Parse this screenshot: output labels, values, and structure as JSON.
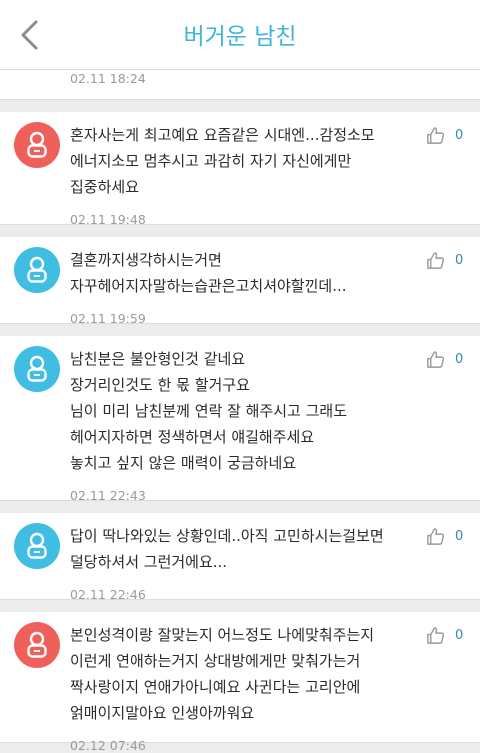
{
  "header": {
    "title": "버거운 남친"
  },
  "colors": {
    "accent": "#3fb6d8",
    "avatar_red": "#f0605a",
    "avatar_blue": "#3fbde3"
  },
  "first_timestamp": "02.11 18:24",
  "comments": [
    {
      "avatar_color": "#f0605a",
      "lines": [
        "혼자사는게 최고예요 요즘같은 시대엔...감정소모",
        "에너지소모 멈추시고 과감히 자기 자신에게만",
        "집중하세요"
      ],
      "timestamp": "02.11 19:48",
      "likes": "0"
    },
    {
      "avatar_color": "#3fbde3",
      "lines": [
        "결혼까지생각하시는거면",
        "자꾸헤어지자말하는습관은고치셔야할낀데..."
      ],
      "timestamp": "02.11 19:59",
      "likes": "0"
    },
    {
      "avatar_color": "#3fbde3",
      "lines": [
        "남친분은 불안형인것 같네요",
        "장거리인것도 한 몫 할거구요",
        "님이 미리 남친분께 연락 잘 해주시고 그래도",
        "헤어지자하면 정색하면서 얘길해주세요",
        "놓치고 싶지 않은 매력이 궁금하네요"
      ],
      "timestamp": "02.11 22:43",
      "likes": "0"
    },
    {
      "avatar_color": "#3fbde3",
      "lines": [
        "답이 딱나와있는 상황인데..아직 고민하시는걸보면",
        "덜당하셔서 그런거에요..."
      ],
      "timestamp": "02.11 22:46",
      "likes": "0"
    },
    {
      "avatar_color": "#f0605a",
      "lines": [
        "본인성격이랑 잘맞는지 어느정도 나에맞춰주는지",
        "이런게 연애하는거지 상대방에게만 맞춰가는거",
        "짝사랑이지 연애가아니예요 사귄다는 고리안에",
        "얽매이지말아요 인생아까워요"
      ],
      "timestamp": "02.12 07:46",
      "likes": "0"
    }
  ]
}
